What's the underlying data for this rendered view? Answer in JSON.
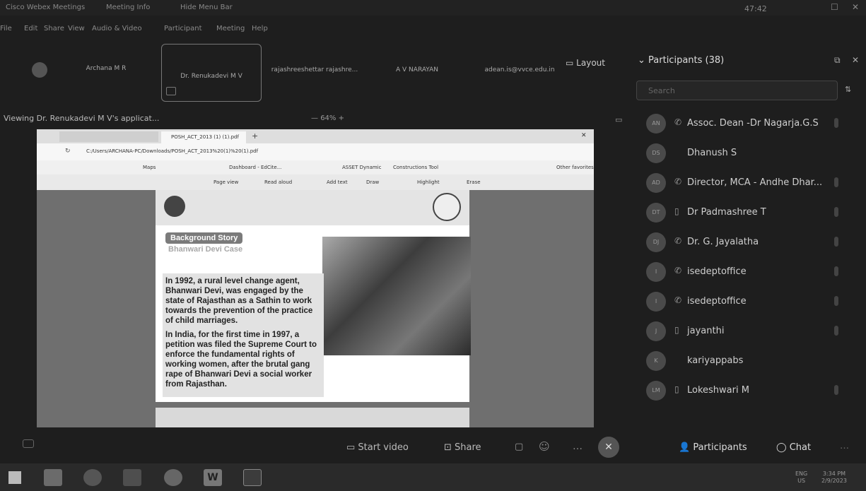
{
  "titlebar": {
    "app": "Cisco Webex Meetings",
    "meeting_info": "Meeting Info",
    "hide_menu": "Hide Menu Bar",
    "timer": "47:42"
  },
  "menu": [
    "File",
    "Edit",
    "Share",
    "View",
    "Audio & Video",
    "Participant",
    "Meeting",
    "Help"
  ],
  "video_strip": {
    "tiles": [
      {
        "name": "Archana M R"
      },
      {
        "name": "Dr. Renukadevi M V"
      },
      {
        "name": "rajashreeshettar rajashre..."
      },
      {
        "name": "A V NARAYAN"
      },
      {
        "name": "adean.is@vvce.edu.in"
      }
    ],
    "layout_label": "Layout"
  },
  "share_header": {
    "viewing": "Viewing Dr. Renukadevi M V's applicat...",
    "zoom": "64%"
  },
  "browser": {
    "tab2": "POSH_ACT_2013 (1) (1).pdf",
    "url": "C:/Users/ARCHANA-PC/Downloads/POSH_ACT_2013%20(1)%20(1).pdf",
    "favorites": [
      "Maps",
      "Dashboard - EdCite...",
      "ASSET Dynamic",
      "Constructions Tool",
      "Other favorites"
    ],
    "pdf_tools": [
      "Page view",
      "Read aloud",
      "Add text",
      "Draw",
      "Highlight",
      "Erase"
    ]
  },
  "slide": {
    "badge": "Background Story",
    "subtitle": "Bhanwari Devi Case",
    "bullets": [
      "In 1992, a rural level change agent, Bhanwari Devi, was engaged by the state of Rajasthan as a Sathin to work towards the prevention of the practice of child marriages.",
      "In India, for the first time in 1997, a petition was filed the Supreme Court to enforce the fundamental rights of working women, after the brutal gang rape of Bhanwari Devi a social worker from Rajasthan."
    ]
  },
  "participants_panel": {
    "title": "Participants (38)",
    "search_placeholder": "Search",
    "list": [
      {
        "initials": "AN",
        "name": "Assoc. Dean -Dr Nagarja.G.S"
      },
      {
        "initials": "DS",
        "name": "Dhanush S"
      },
      {
        "initials": "AD",
        "name": "Director, MCA - Andhe Dhar..."
      },
      {
        "initials": "DT",
        "name": "Dr Padmashree T"
      },
      {
        "initials": "DJ",
        "name": "Dr. G. Jayalatha"
      },
      {
        "initials": "I",
        "name": "isedeptoffice"
      },
      {
        "initials": "I",
        "name": "isedeptoffice"
      },
      {
        "initials": "J",
        "name": "jayanthi"
      },
      {
        "initials": "K",
        "name": "kariyappabs"
      },
      {
        "initials": "LM",
        "name": "Lokeshwari M"
      }
    ]
  },
  "controls": {
    "start_video": "Start video",
    "share": "Share",
    "participants": "Participants",
    "chat": "Chat"
  },
  "taskbar": {
    "lang": "ENG",
    "region": "US",
    "time": "3:34 PM",
    "date": "2/9/2023"
  }
}
